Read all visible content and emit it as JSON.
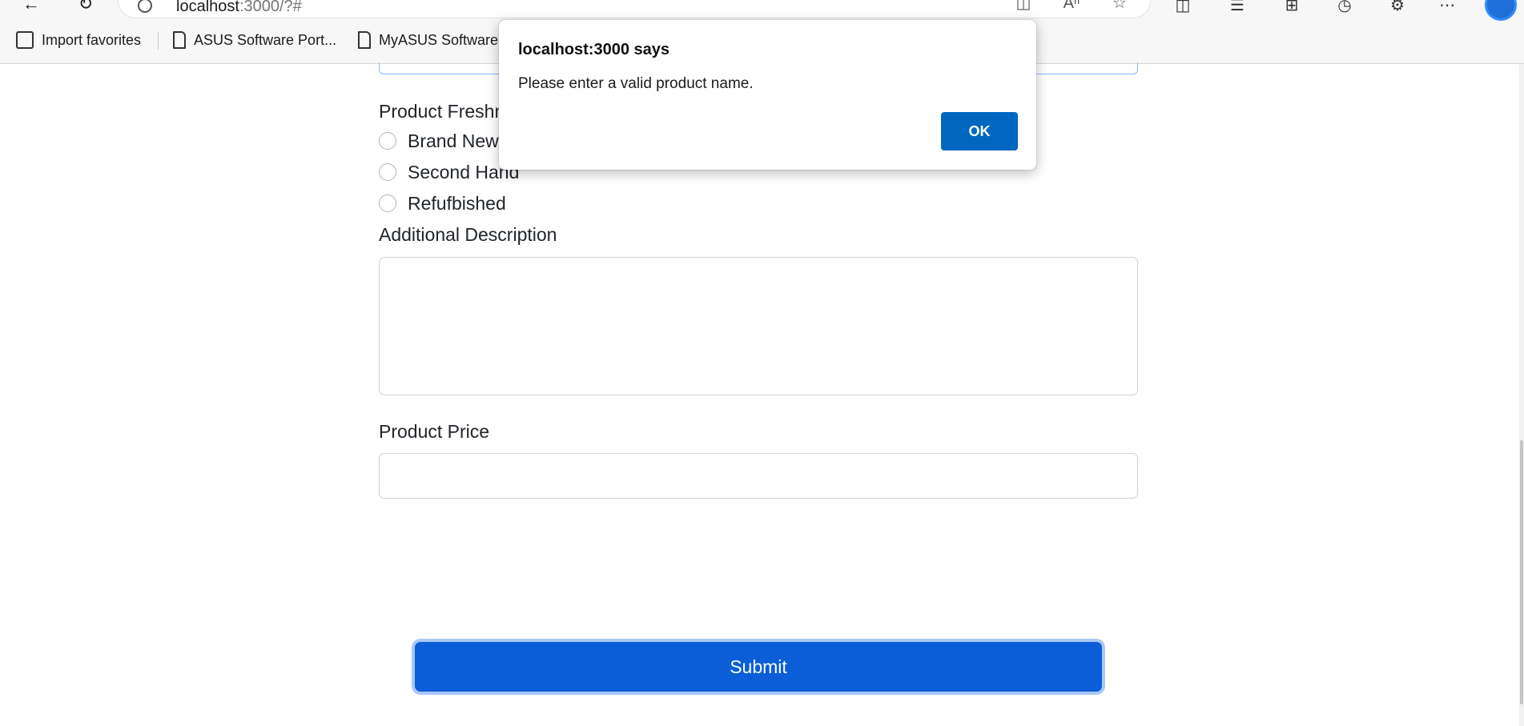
{
  "browser": {
    "url_host": "localhost",
    "url_rest": ":3000/?#",
    "favorites": [
      {
        "label": "Import favorites"
      },
      {
        "label": "ASUS Software Port..."
      },
      {
        "label": "MyASUS Software"
      }
    ]
  },
  "form": {
    "freshness_label": "Product Freshness",
    "freshness_options": [
      "Brand New",
      "Second Hand",
      "Refufbished"
    ],
    "description_label": "Additional Description",
    "description_value": "",
    "price_label": "Product Price",
    "price_value": "",
    "submit_label": "Submit"
  },
  "dialog": {
    "title": "localhost:3000 says",
    "message": "Please enter a valid product name.",
    "ok_label": "OK"
  },
  "colors": {
    "submit_bg": "#0b5ed7",
    "ok_bg": "#0067c0",
    "focus_ring": "#a9c8f5"
  }
}
